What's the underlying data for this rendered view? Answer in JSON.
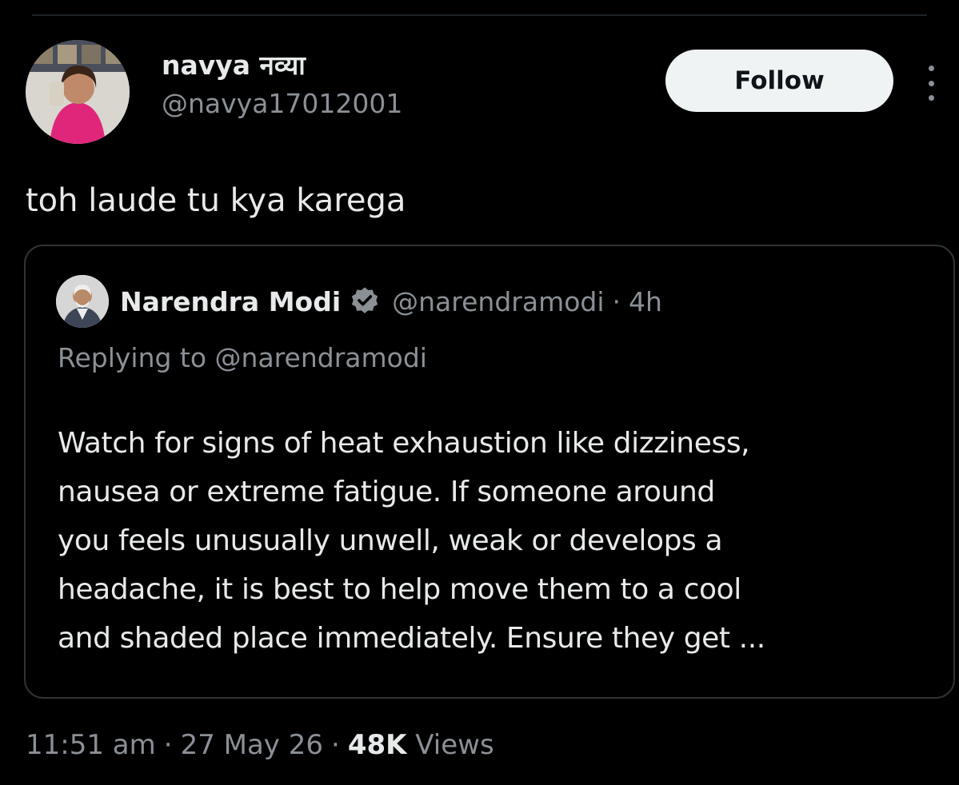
{
  "tweet": {
    "author": {
      "display_name": "navya नव्या",
      "handle": "@navya17012001",
      "avatar": "avatar-photo"
    },
    "follow_label": "Follow",
    "more_icon": "more-vertical-icon",
    "text": "toh laude tu kya karega",
    "timestamp": "11:51 am",
    "date": "27 May 26",
    "views_count": "48K",
    "views_label": "Views",
    "separator": "·"
  },
  "quote": {
    "author": {
      "display_name": "Narendra Modi",
      "handle": "@narendramodi",
      "verified_icon": "verified-badge-icon",
      "avatar": "avatar-photo"
    },
    "separator": "·",
    "time": "4h",
    "replying_prefix": "Replying to",
    "replying_to": "@narendramodi",
    "body_lines": [
      "Watch for signs of heat exhaustion like dizziness,",
      "nausea or extreme fatigue. If someone around",
      "you feels unusually unwell, weak or develops a",
      "headache, it is best to help move them to a cool",
      "and shaded place immediately. Ensure they get ..."
    ]
  },
  "colors": {
    "background": "#000000",
    "primary_text": "#e7e9ea",
    "secondary_text": "#8b9096",
    "border": "#2f3336",
    "follow_bg": "#eff3f4",
    "verified": "#8b9096"
  }
}
